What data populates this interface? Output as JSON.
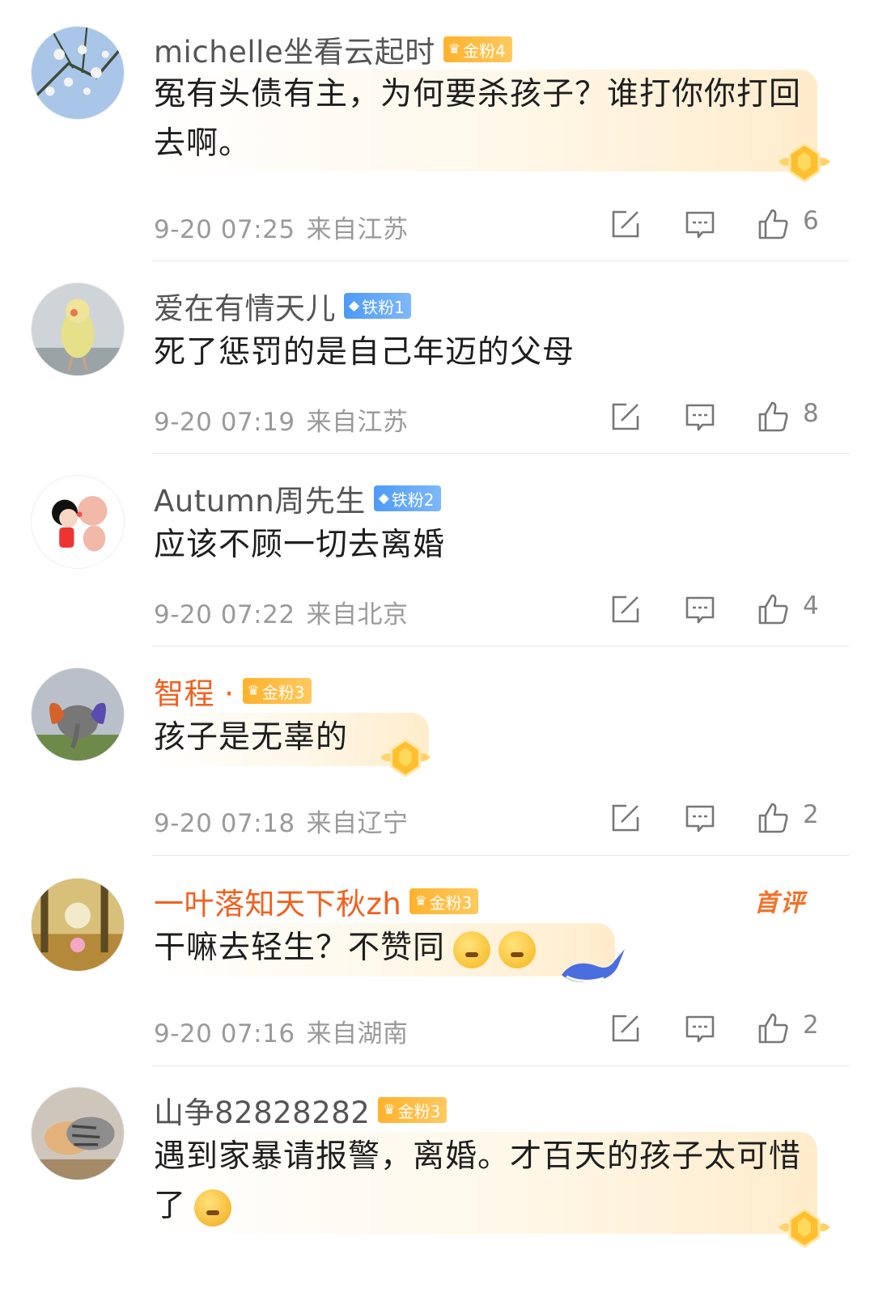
{
  "comments": [
    {
      "username": "michelle坐看云起时",
      "badge": "金粉4",
      "text": "冤有头债有主，为何要杀孩子？谁打你你打回去啊。",
      "time": "9-20 07:25",
      "location": "来自江苏",
      "likes": "6"
    },
    {
      "username": "爱在有情天儿",
      "badge": "铁粉1",
      "text": "死了惩罚的是自己年迈的父母",
      "time": "9-20 07:19",
      "location": "来自江苏",
      "likes": "8"
    },
    {
      "username": "Autumn周先生",
      "badge": "铁粉2",
      "text": "应该不顾一切去离婚",
      "time": "9-20 07:22",
      "location": "来自北京",
      "likes": "4"
    },
    {
      "username": "智程 ·",
      "badge": "金粉3",
      "text": "孩子是无辜的",
      "time": "9-20 07:18",
      "location": "来自辽宁",
      "likes": "2"
    },
    {
      "username": "一叶落知天下秋zh",
      "badge": "金粉3",
      "tag": "首评",
      "text": "干嘛去轻生？不赞同",
      "time": "9-20 07:16",
      "location": "来自湖南",
      "likes": "2"
    },
    {
      "username": "山争82828282",
      "badge": "金粉3",
      "text": "遇到家暴请报警，离婚。才百天的孩子太可惜了"
    }
  ],
  "icons": {
    "repost": "repost-icon",
    "comment": "comment-icon",
    "like": "like-icon"
  },
  "colors": {
    "vip_name": "#f2601e",
    "gold_badge": "#ffb22c",
    "iron_badge": "#4d9bf7",
    "meta": "#9a9a9a"
  }
}
